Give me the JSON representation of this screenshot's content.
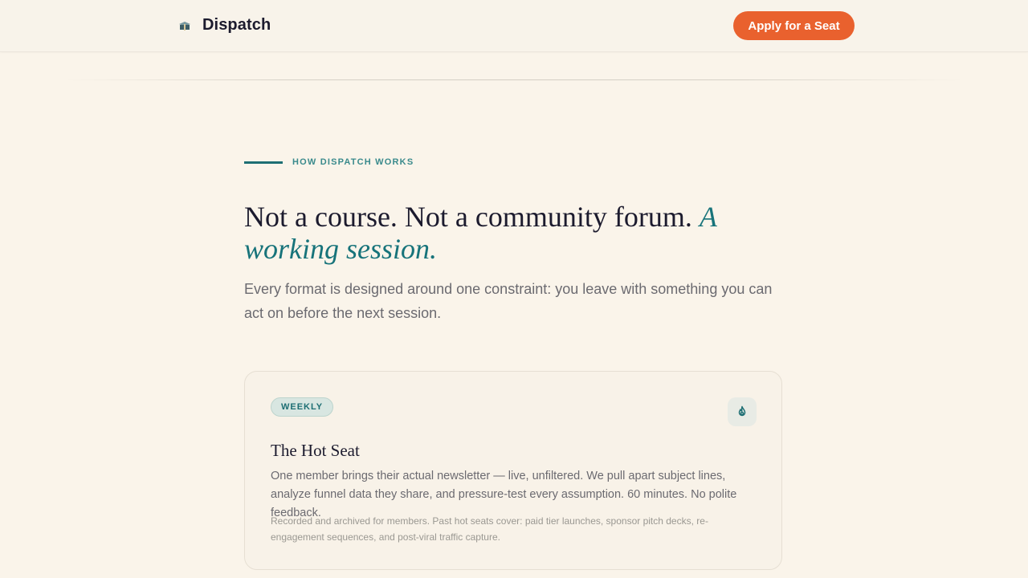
{
  "header": {
    "brand_name": "Dispatch",
    "brand_icon": "stacked-papers-icon",
    "cta_label": "Apply for a Seat"
  },
  "section": {
    "eyebrow": "HOW DISPATCH WORKS",
    "headline_plain": "Not a course. Not a community forum. ",
    "headline_accent": "A working session.",
    "subhead": "Every format is designed around one constraint: you leave with something you can act on before the next session."
  },
  "card": {
    "badge": "WEEKLY",
    "icon": "flame-icon",
    "title": "The Hot Seat",
    "description": "One member brings their actual newsletter — live, unfiltered. We pull apart subject lines, analyze funnel data they share, and pressure-test every assumption. 60 minutes. No polite feedback.",
    "note": "Recorded and archived for members. Past hot seats cover: paid tier launches, sponsor pitch decks, re-engagement sequences, and post-viral traffic capture."
  },
  "colors": {
    "background": "#faf4ea",
    "accent_orange": "#e9612e",
    "accent_teal": "#17737a",
    "text_dark": "#1c1b2e",
    "text_muted": "#6b6a70"
  }
}
